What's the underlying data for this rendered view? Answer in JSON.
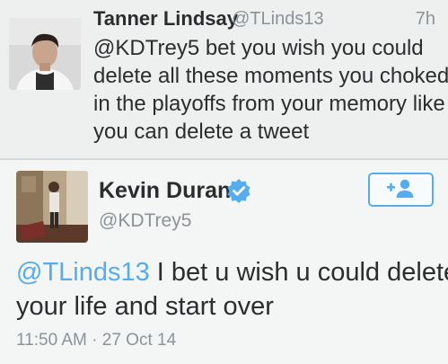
{
  "reply_tweet": {
    "name": "Tanner Lindsay",
    "handle": "@TLinds13",
    "time": "7h",
    "text_lines": [
      "@KDTrey5 bet you wish you could",
      "delete all these moments you choked",
      "in the playoffs from your memory like",
      "you can delete a tweet"
    ]
  },
  "main_tweet": {
    "name": "Kevin Durant",
    "handle": "@KDTrey5",
    "verified_icon": "verified-badge-icon",
    "follow_icon": "add-user-icon",
    "mention": "@TLinds13",
    "text_rest": " I bet u wish u could delete",
    "text_line2": "your life and start over",
    "time": "11:50 AM",
    "separator": "·",
    "date": "27 Oct 14"
  },
  "colors": {
    "accent": "#55acee",
    "muted": "#8b9399",
    "text": "#2b2d2f"
  }
}
